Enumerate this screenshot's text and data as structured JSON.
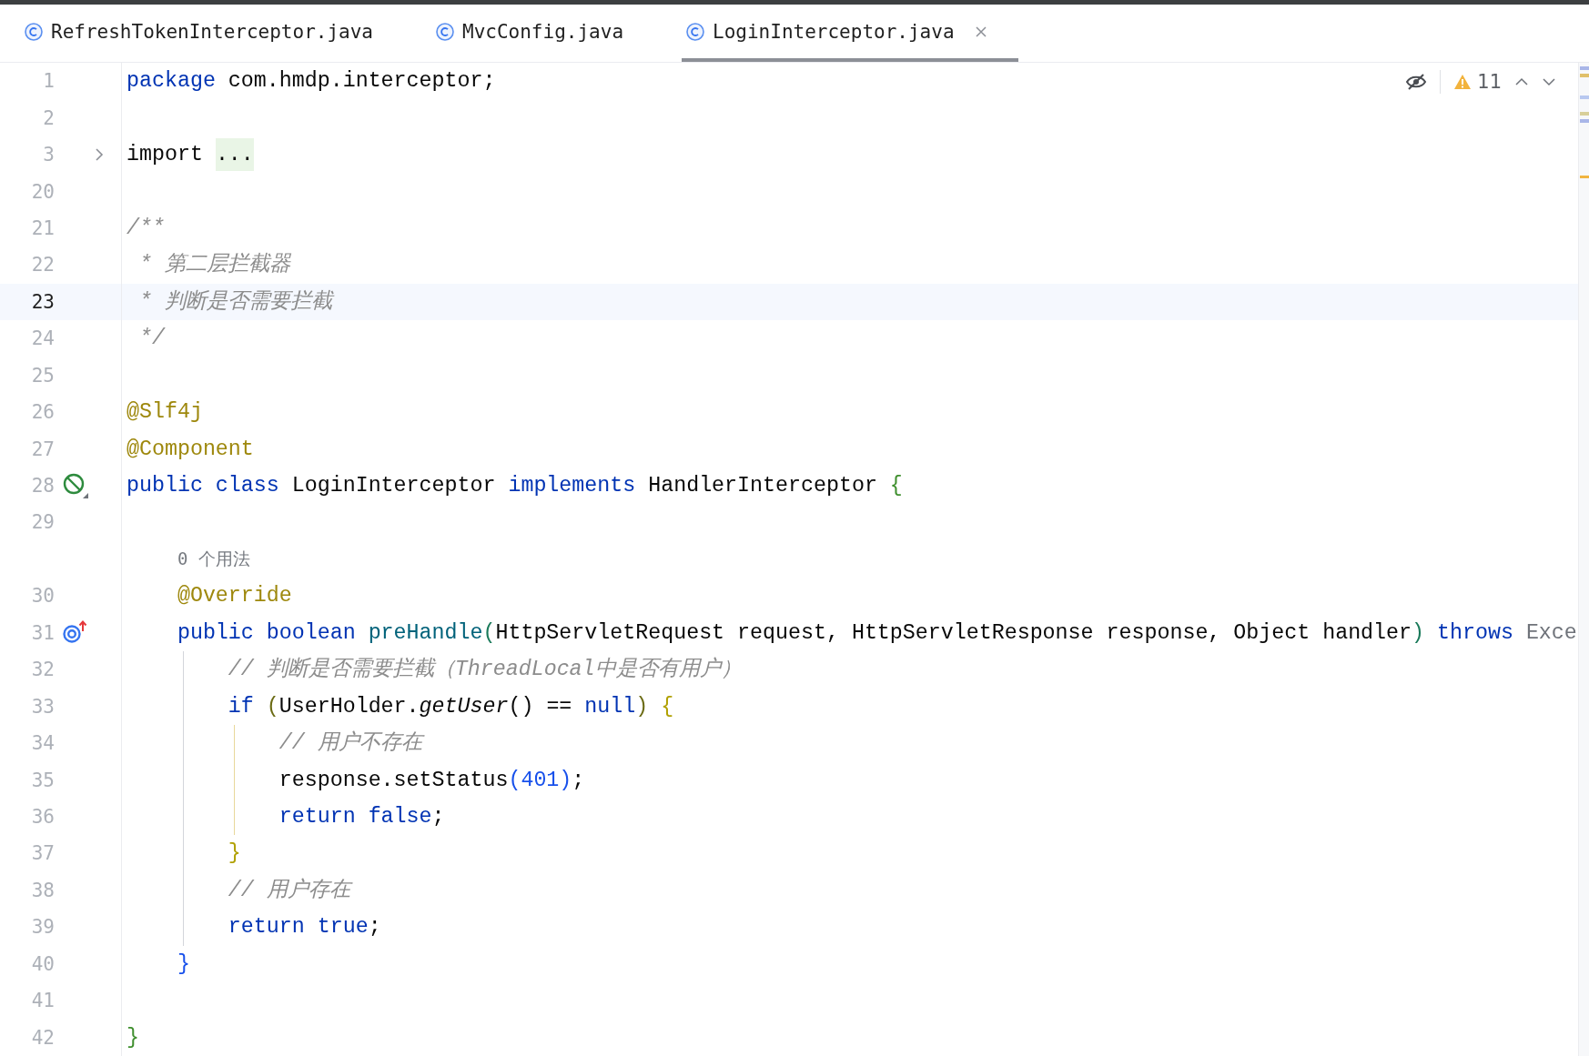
{
  "tabs": [
    {
      "label": "RefreshTokenInterceptor.java",
      "selected": false
    },
    {
      "label": "MvcConfig.java",
      "selected": false
    },
    {
      "label": "LoginInterceptor.java",
      "selected": true
    }
  ],
  "inspections": {
    "count": "11"
  },
  "lines": [
    {
      "kind": "code",
      "number": "1",
      "current": false,
      "tokens": [
        {
          "kind": "keyword",
          "text": "package"
        },
        {
          "kind": "plain",
          "text": " com.hmdp.interceptor;"
        }
      ]
    },
    {
      "kind": "code",
      "number": "2",
      "current": false
    },
    {
      "kind": "code",
      "number": "3",
      "current": false,
      "tokens": [
        {
          "kind": "plain",
          "text": "import "
        },
        {
          "kind": "folded",
          "text": "..."
        }
      ]
    },
    {
      "kind": "code",
      "number": "20",
      "current": false
    },
    {
      "kind": "code",
      "number": "21",
      "current": false,
      "tokens": [
        {
          "kind": "comment",
          "text": "/**"
        }
      ]
    },
    {
      "kind": "code",
      "number": "22",
      "current": false,
      "tokens": [
        {
          "kind": "comment",
          "text": " * 第二层拦截器"
        }
      ]
    },
    {
      "kind": "code",
      "number": "23",
      "current": true,
      "tokens": [
        {
          "kind": "comment",
          "text": " * 判断是否需要拦截"
        }
      ]
    },
    {
      "kind": "code",
      "number": "24",
      "current": false,
      "tokens": [
        {
          "kind": "comment",
          "text": " */"
        }
      ]
    },
    {
      "kind": "code",
      "number": "25",
      "current": false
    },
    {
      "kind": "code",
      "number": "26",
      "current": false,
      "tokens": [
        {
          "kind": "annotation",
          "text": "@Slf4j"
        }
      ]
    },
    {
      "kind": "code",
      "number": "27",
      "current": false,
      "tokens": [
        {
          "kind": "annotation",
          "text": "@Component"
        }
      ]
    },
    {
      "kind": "code",
      "number": "28",
      "current": false,
      "gutter_icon": {
        "kind": "bean"
      },
      "tokens": [
        {
          "kind": "keyword",
          "text": "public class"
        },
        {
          "kind": "plain",
          "text": " LoginInterceptor "
        },
        {
          "kind": "keyword",
          "text": "implements"
        },
        {
          "kind": "plain",
          "text": " HandlerInterceptor "
        },
        {
          "kind": "bracket",
          "text": "{"
        }
      ]
    },
    {
      "kind": "code",
      "number": "29",
      "current": false
    },
    {
      "kind": "hint",
      "text": "0 个用法"
    },
    {
      "kind": "code",
      "number": "30",
      "current": false,
      "tokens": [
        {
          "kind": "annotation",
          "text": "    @Override"
        }
      ]
    },
    {
      "kind": "code",
      "number": "31",
      "current": false,
      "gutter_icon": {
        "kind": "override"
      },
      "tokens": [
        {
          "kind": "keyword",
          "text": "    public boolean"
        },
        {
          "kind": "method",
          "text": " preHandle"
        },
        {
          "kind": "bracket",
          "text": "("
        },
        {
          "kind": "plain",
          "text": "HttpServletRequest request, HttpServletResponse response, Object handler"
        },
        {
          "kind": "bracket",
          "text": ")"
        },
        {
          "kind": "keyword",
          "text": " throws"
        },
        {
          "kind": "unresolved",
          "text": " Exce"
        }
      ]
    },
    {
      "kind": "code",
      "number": "32",
      "current": false,
      "tokens": [
        {
          "kind": "comment",
          "text": "        // 判断是否需要拦截（ThreadLocal中是否有用户）"
        }
      ]
    },
    {
      "kind": "code",
      "number": "33",
      "current": false,
      "tokens": [
        {
          "kind": "keyword",
          "text": "        if "
        },
        {
          "kind": "bracket",
          "text": "("
        },
        {
          "kind": "plain",
          "text": "UserHolder."
        },
        {
          "kind": "static",
          "text": "getUser"
        },
        {
          "kind": "plain",
          "text": "() == "
        },
        {
          "kind": "keyword",
          "text": "null"
        },
        {
          "kind": "bracket",
          "text": ")"
        },
        {
          "kind": "bracket",
          "text": " {"
        }
      ]
    },
    {
      "kind": "code",
      "number": "34",
      "current": false,
      "tokens": [
        {
          "kind": "comment",
          "text": "            // 用户不存在"
        }
      ]
    },
    {
      "kind": "code",
      "number": "35",
      "current": false,
      "tokens": [
        {
          "kind": "plain",
          "text": "            response.setStatus"
        },
        {
          "kind": "bracket",
          "text": "("
        },
        {
          "kind": "number",
          "text": "401"
        },
        {
          "kind": "bracket",
          "text": ")"
        },
        {
          "kind": "plain",
          "text": ";"
        }
      ]
    },
    {
      "kind": "code",
      "number": "36",
      "current": false,
      "tokens": [
        {
          "kind": "keyword",
          "text": "            return false"
        },
        {
          "kind": "plain",
          "text": ";"
        }
      ]
    },
    {
      "kind": "code",
      "number": "37",
      "current": false,
      "tokens": [
        {
          "kind": "bracket",
          "text": "        }"
        }
      ]
    },
    {
      "kind": "code",
      "number": "38",
      "current": false,
      "tokens": [
        {
          "kind": "comment",
          "text": "        // 用户存在"
        }
      ]
    },
    {
      "kind": "code",
      "number": "39",
      "current": false,
      "tokens": [
        {
          "kind": "keyword",
          "text": "        return true"
        },
        {
          "kind": "plain",
          "text": ";"
        }
      ]
    },
    {
      "kind": "code",
      "number": "40",
      "current": false,
      "tokens": [
        {
          "kind": "bracket",
          "text": "    }"
        }
      ]
    },
    {
      "kind": "code",
      "number": "41",
      "current": false
    },
    {
      "kind": "code",
      "number": "42",
      "current": false,
      "tokens": [
        {
          "kind": "bracket",
          "text": "}"
        }
      ]
    }
  ]
}
